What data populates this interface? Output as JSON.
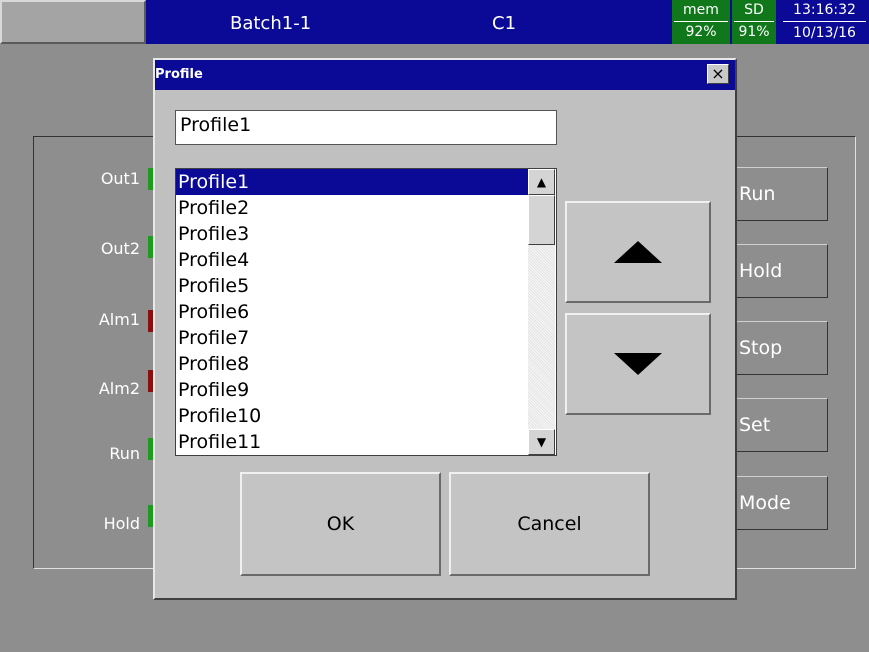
{
  "header": {
    "batch_title": "Batch1-1",
    "channel": "C1",
    "mem_label": "mem",
    "mem_value": "92%",
    "sd_label": "SD",
    "sd_value": "91%",
    "time": "13:16:32",
    "date": "10/13/16"
  },
  "indicators": [
    {
      "label": "Out1",
      "color": "#1e9a1e"
    },
    {
      "label": "Out2",
      "color": "#1e9a1e"
    },
    {
      "label": "Alm1",
      "color": "#8a1010"
    },
    {
      "label": "Alm2",
      "color": "#8a1010"
    },
    {
      "label": "Run",
      "color": "#1e9a1e"
    },
    {
      "label": "Hold",
      "color": "#1e9a1e"
    }
  ],
  "background_buttons": [
    "Run",
    "Hold",
    "Stop",
    "Set",
    "Mode"
  ],
  "dialog": {
    "title": "Profile",
    "close_label": "×",
    "name_value": "Profile1",
    "items": [
      "Profile1",
      "Profile2",
      "Profile3",
      "Profile4",
      "Profile5",
      "Profile6",
      "Profile7",
      "Profile8",
      "Profile9",
      "Profile10",
      "Profile11"
    ],
    "selected_index": 0,
    "ok_label": "OK",
    "cancel_label": "Cancel"
  },
  "colors": {
    "title_bar": "#0a0a96",
    "status_green": "#10781a",
    "dialog_bg": "#c0c0c0",
    "screen_bg": "#8e8e8e"
  }
}
